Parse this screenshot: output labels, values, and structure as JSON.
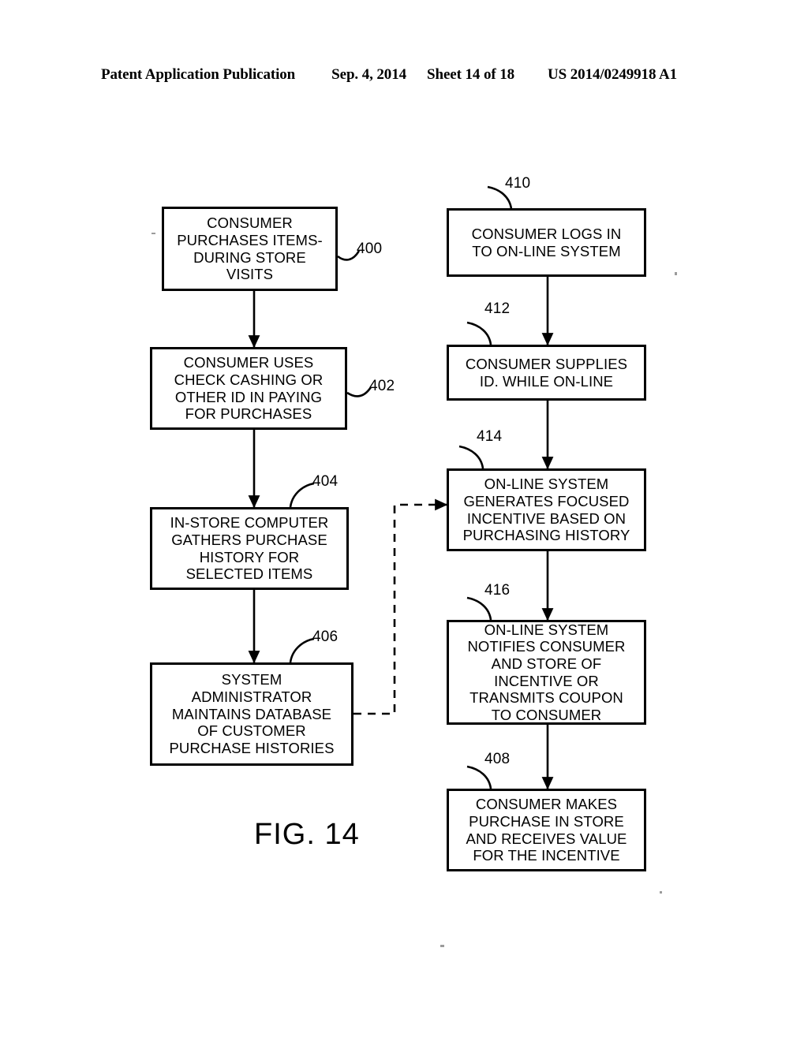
{
  "header": {
    "publication": "Patent Application Publication",
    "date": "Sep. 4, 2014",
    "sheet": "Sheet 14 of 18",
    "patent_number": "US 2014/0249918 A1"
  },
  "figure": {
    "caption": "FIG. 14"
  },
  "flowchart": {
    "type": "flowchart",
    "columns": [
      {
        "name": "in-store-process",
        "nodes": [
          "400",
          "402",
          "404",
          "406"
        ]
      },
      {
        "name": "on-line-process",
        "nodes": [
          "410",
          "412",
          "414",
          "416",
          "408"
        ]
      }
    ],
    "nodes": {
      "n400": {
        "ref": "400",
        "text": "CONSUMER\nPURCHASES ITEMS-\nDURING STORE\nVISITS"
      },
      "n402": {
        "ref": "402",
        "text": "CONSUMER USES\nCHECK CASHING OR\nOTHER ID IN PAYING\nFOR PURCHASES"
      },
      "n404": {
        "ref": "404",
        "text": "IN-STORE COMPUTER\nGATHERS PURCHASE\nHISTORY FOR\nSELECTED ITEMS"
      },
      "n406": {
        "ref": "406",
        "text": "SYSTEM\nADMINISTRATOR\nMAINTAINS DATABASE\nOF CUSTOMER\nPURCHASE HISTORIES"
      },
      "n410": {
        "ref": "410",
        "text": "CONSUMER LOGS IN\nTO ON-LINE SYSTEM"
      },
      "n412": {
        "ref": "412",
        "text": "CONSUMER SUPPLIES\nID. WHILE ON-LINE"
      },
      "n414": {
        "ref": "414",
        "text": "ON-LINE SYSTEM\nGENERATES FOCUSED\nINCENTIVE BASED ON\nPURCHASING HISTORY"
      },
      "n416": {
        "ref": "416",
        "text": "ON-LINE SYSTEM\nNOTIFIES CONSUMER\nAND STORE OF\nINCENTIVE OR\nTRANSMITS COUPON\nTO CONSUMER"
      },
      "n408": {
        "ref": "408",
        "text": "CONSUMER MAKES\nPURCHASE IN STORE\nAND RECEIVES VALUE\nFOR THE INCENTIVE"
      }
    },
    "edges": [
      {
        "from": "400",
        "to": "402",
        "style": "solid"
      },
      {
        "from": "402",
        "to": "404",
        "style": "solid"
      },
      {
        "from": "404",
        "to": "406",
        "style": "solid"
      },
      {
        "from": "410",
        "to": "412",
        "style": "solid"
      },
      {
        "from": "412",
        "to": "414",
        "style": "solid"
      },
      {
        "from": "414",
        "to": "416",
        "style": "solid"
      },
      {
        "from": "416",
        "to": "408",
        "style": "solid"
      },
      {
        "from": "406",
        "to": "414",
        "style": "dashed"
      }
    ]
  }
}
